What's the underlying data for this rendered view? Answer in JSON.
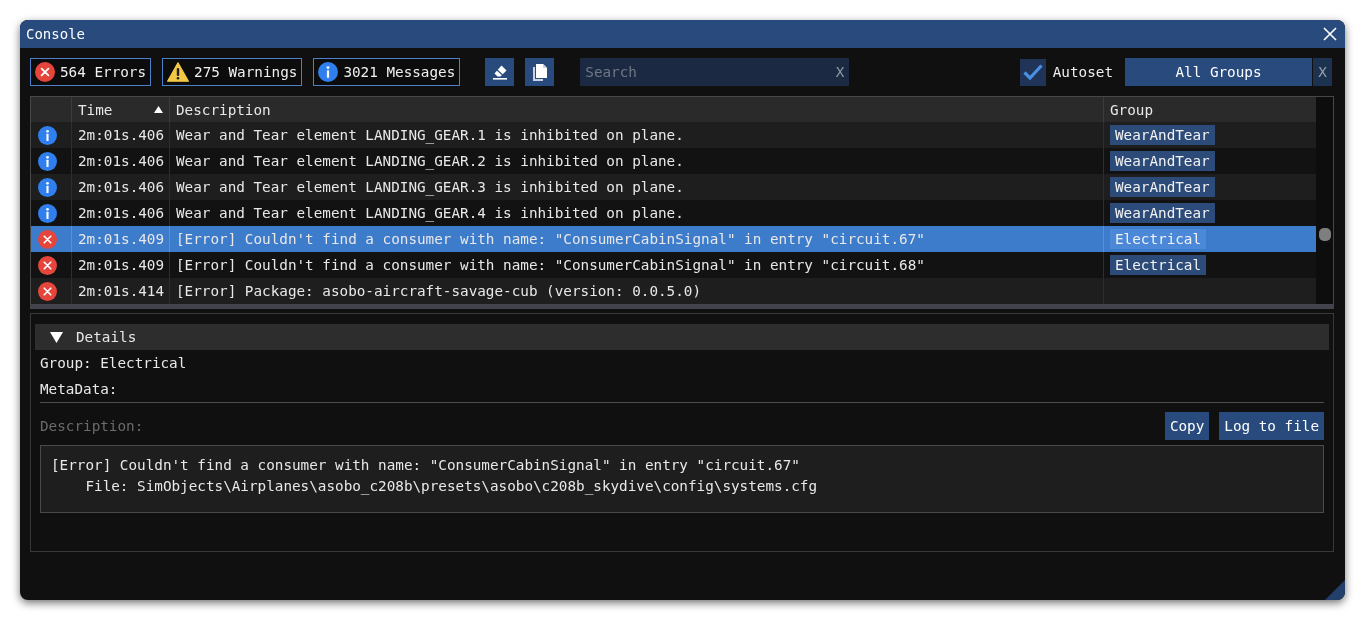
{
  "window": {
    "title": "Console"
  },
  "toolbar": {
    "filters": [
      {
        "kind": "error",
        "label": "564 Errors",
        "on": true
      },
      {
        "kind": "warning",
        "label": "275 Warnings",
        "on": true
      },
      {
        "kind": "info",
        "label": "3021 Messages",
        "on": true
      }
    ],
    "search": {
      "placeholder": "Search",
      "clear_label": "X"
    },
    "autoset": {
      "label": "Autoset",
      "checked": true
    },
    "group_filter": {
      "value": "All Groups",
      "clear_label": "X"
    }
  },
  "table": {
    "columns": [
      {
        "label": "Time",
        "sorted": true
      },
      {
        "label": "Description",
        "sorted": false
      },
      {
        "label": "Group",
        "sorted": false
      }
    ],
    "rows": [
      {
        "kind": "info",
        "time": "2m:01s.406",
        "description": "Wear and Tear element LANDING_GEAR.1 is inhibited on plane.",
        "group": "WearAndTear",
        "selected": false
      },
      {
        "kind": "info",
        "time": "2m:01s.406",
        "description": "Wear and Tear element LANDING_GEAR.2 is inhibited on plane.",
        "group": "WearAndTear",
        "selected": false
      },
      {
        "kind": "info",
        "time": "2m:01s.406",
        "description": "Wear and Tear element LANDING_GEAR.3 is inhibited on plane.",
        "group": "WearAndTear",
        "selected": false
      },
      {
        "kind": "info",
        "time": "2m:01s.406",
        "description": "Wear and Tear element LANDING_GEAR.4 is inhibited on plane.",
        "group": "WearAndTear",
        "selected": false
      },
      {
        "kind": "error",
        "time": "2m:01s.409",
        "description": "[Error] Couldn't find a consumer with name: \"ConsumerCabinSignal\" in entry \"circuit.67\"",
        "group": "Electrical",
        "selected": true
      },
      {
        "kind": "error",
        "time": "2m:01s.409",
        "description": "[Error] Couldn't find a consumer with name: \"ConsumerCabinSignal\" in entry \"circuit.68\"",
        "group": "Electrical",
        "selected": false
      },
      {
        "kind": "error",
        "time": "2m:01s.414",
        "description": "[Error] Package: asobo-aircraft-savage-cub (version: 0.0.5.0)",
        "selected": false
      }
    ]
  },
  "details": {
    "title": "Details",
    "expanded": true,
    "lines": [
      "Group: Electrical",
      "MetaData:"
    ],
    "description_label": "Description:",
    "buttons": [
      "Copy",
      "Log to file"
    ],
    "description": "[Error] Couldn't find a consumer with name: \"ConsumerCabinSignal\" in entry \"circuit.67\"\n    File: SimObjects\\Airplanes\\asobo_c208b\\presets\\asobo\\c208b_skydive\\config\\systems.cfg"
  }
}
